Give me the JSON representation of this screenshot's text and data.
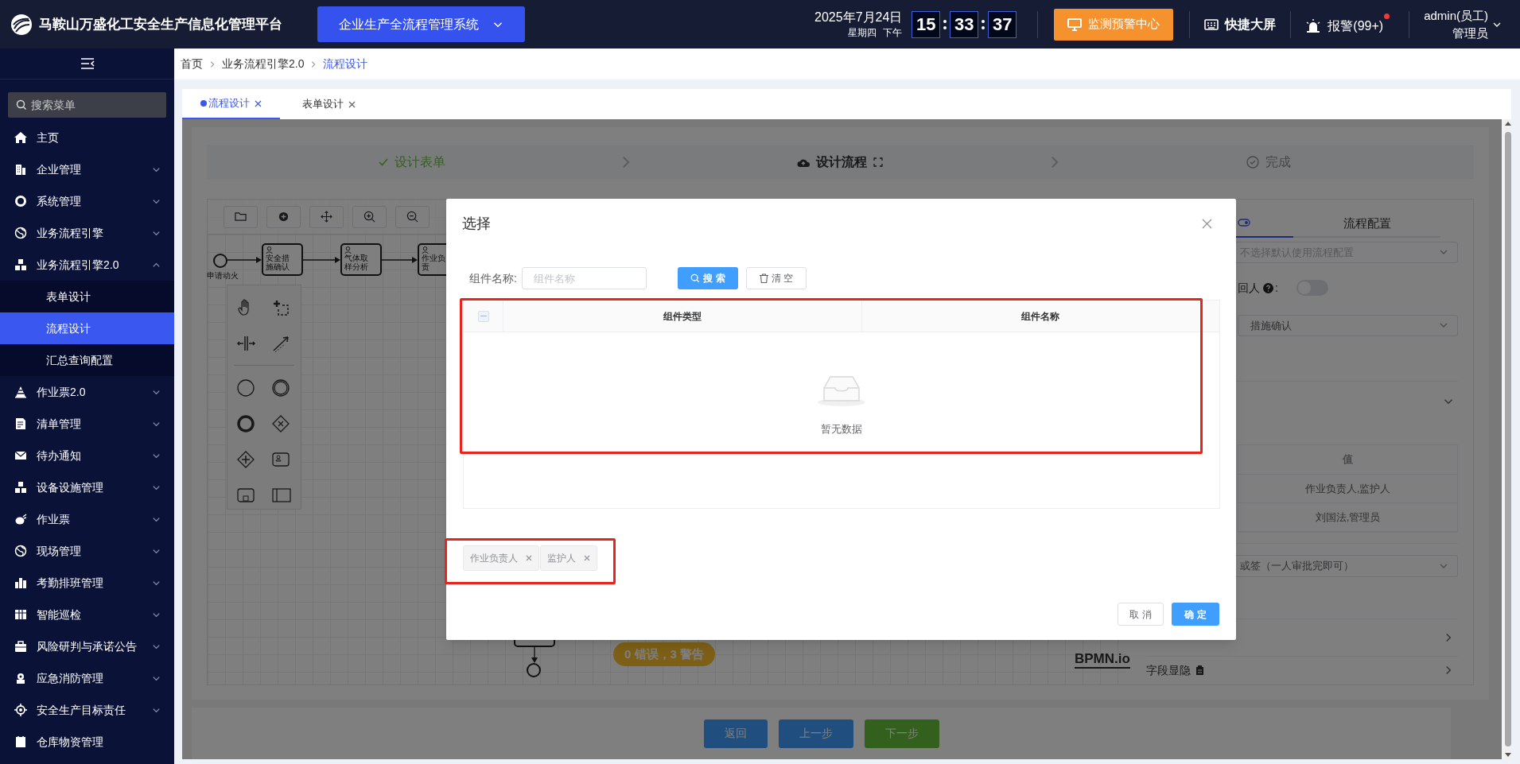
{
  "header": {
    "title": "马鞍山万盛化工安全生产信息化管理平台",
    "system_switch": "企业生产全流程管理系统",
    "date": "2025年7月24日",
    "weekday": "星期四",
    "period": "下午",
    "time": [
      "15",
      "33",
      "37"
    ],
    "monitor_button": "监测预警中心",
    "big_screen": "快捷大屏",
    "alarm": "报警(99+)",
    "alarm_dot": true,
    "user": "admin(员工)",
    "role": "管理员"
  },
  "sidebar": {
    "search_placeholder": "搜索菜单",
    "items": [
      {
        "label": "主页",
        "expandable": false
      },
      {
        "label": "企业管理",
        "expandable": true
      },
      {
        "label": "系统管理",
        "expandable": true
      },
      {
        "label": "业务流程引擎",
        "expandable": true
      },
      {
        "label": "业务流程引擎2.0",
        "expandable": true,
        "expanded": true,
        "children": [
          {
            "label": "表单设计",
            "selected": false
          },
          {
            "label": "流程设计",
            "selected": true
          },
          {
            "label": "汇总查询配置",
            "selected": false
          }
        ]
      },
      {
        "label": "作业票2.0",
        "expandable": true
      },
      {
        "label": "清单管理",
        "expandable": true
      },
      {
        "label": "待办通知",
        "expandable": true
      },
      {
        "label": "设备设施管理",
        "expandable": true
      },
      {
        "label": "作业票",
        "expandable": true
      },
      {
        "label": "现场管理",
        "expandable": true
      },
      {
        "label": "考勤排班管理",
        "expandable": true
      },
      {
        "label": "智能巡检",
        "expandable": true
      },
      {
        "label": "风险研判与承诺公告",
        "expandable": true
      },
      {
        "label": "应急消防管理",
        "expandable": true
      },
      {
        "label": "安全生产目标责任",
        "expandable": true
      },
      {
        "label": "仓库物资管理",
        "expandable": false
      }
    ]
  },
  "breadcrumb": [
    {
      "label": "首页",
      "current": false
    },
    {
      "label": "业务流程引擎2.0",
      "current": false
    },
    {
      "label": "流程设计",
      "current": true
    }
  ],
  "page_tabs": [
    {
      "label": "流程设计",
      "selected": true
    },
    {
      "label": "表单设计",
      "selected": false
    }
  ],
  "steps": [
    {
      "label": "设计表单",
      "done": true,
      "active": false
    },
    {
      "label": "设计流程",
      "done": false,
      "active": true
    },
    {
      "label": "完成",
      "done": false,
      "active": false
    }
  ],
  "designer": {
    "nodes": [
      {
        "kind": "start",
        "label": "申请动火"
      },
      {
        "kind": "task",
        "label": "安全措施确认"
      },
      {
        "kind": "task",
        "label": "气体取样分析"
      },
      {
        "kind": "task",
        "label": "作业负责"
      }
    ],
    "lint_badge": "0 错误，3 警告",
    "brand_mark": "BPMN.io"
  },
  "properties_panel": {
    "tabs": [
      {
        "kind": "icon",
        "selected": true
      },
      {
        "kind": "text",
        "label": "流程配置",
        "selected": false
      }
    ],
    "config_select": {
      "placeholder": "不选择默认使用流程配置"
    },
    "reject_switch": {
      "label": "回人",
      "label_suffix": ":",
      "on": false
    },
    "node_select": {
      "value": "措施确认"
    },
    "table": {
      "columns": [
        "值"
      ],
      "rows": [
        [
          "作业负责人,监护人"
        ],
        [
          "刘国法,管理员"
        ]
      ]
    },
    "sign_select": {
      "value": "或签（一人审批完即可）"
    },
    "sections": [
      {
        "label": "字段显隐"
      }
    ]
  },
  "footer_buttons": [
    {
      "label": "返回",
      "kind": "primary"
    },
    {
      "label": "上一步",
      "kind": "primary"
    },
    {
      "label": "下一步",
      "kind": "success"
    }
  ],
  "dialog": {
    "title": "选择",
    "filter": {
      "label": "组件名称:",
      "placeholder": "组件名称"
    },
    "search_button": "搜 索",
    "clear_button": "清 空",
    "table": {
      "header_checkbox": {
        "indeterminate": true
      },
      "columns": [
        "组件类型",
        "组件名称"
      ],
      "empty_text": "暂无数据"
    },
    "selected_tags": [
      "作业负责人",
      "监护人"
    ],
    "cancel_button": "取 消",
    "confirm_button": "确 定"
  }
}
